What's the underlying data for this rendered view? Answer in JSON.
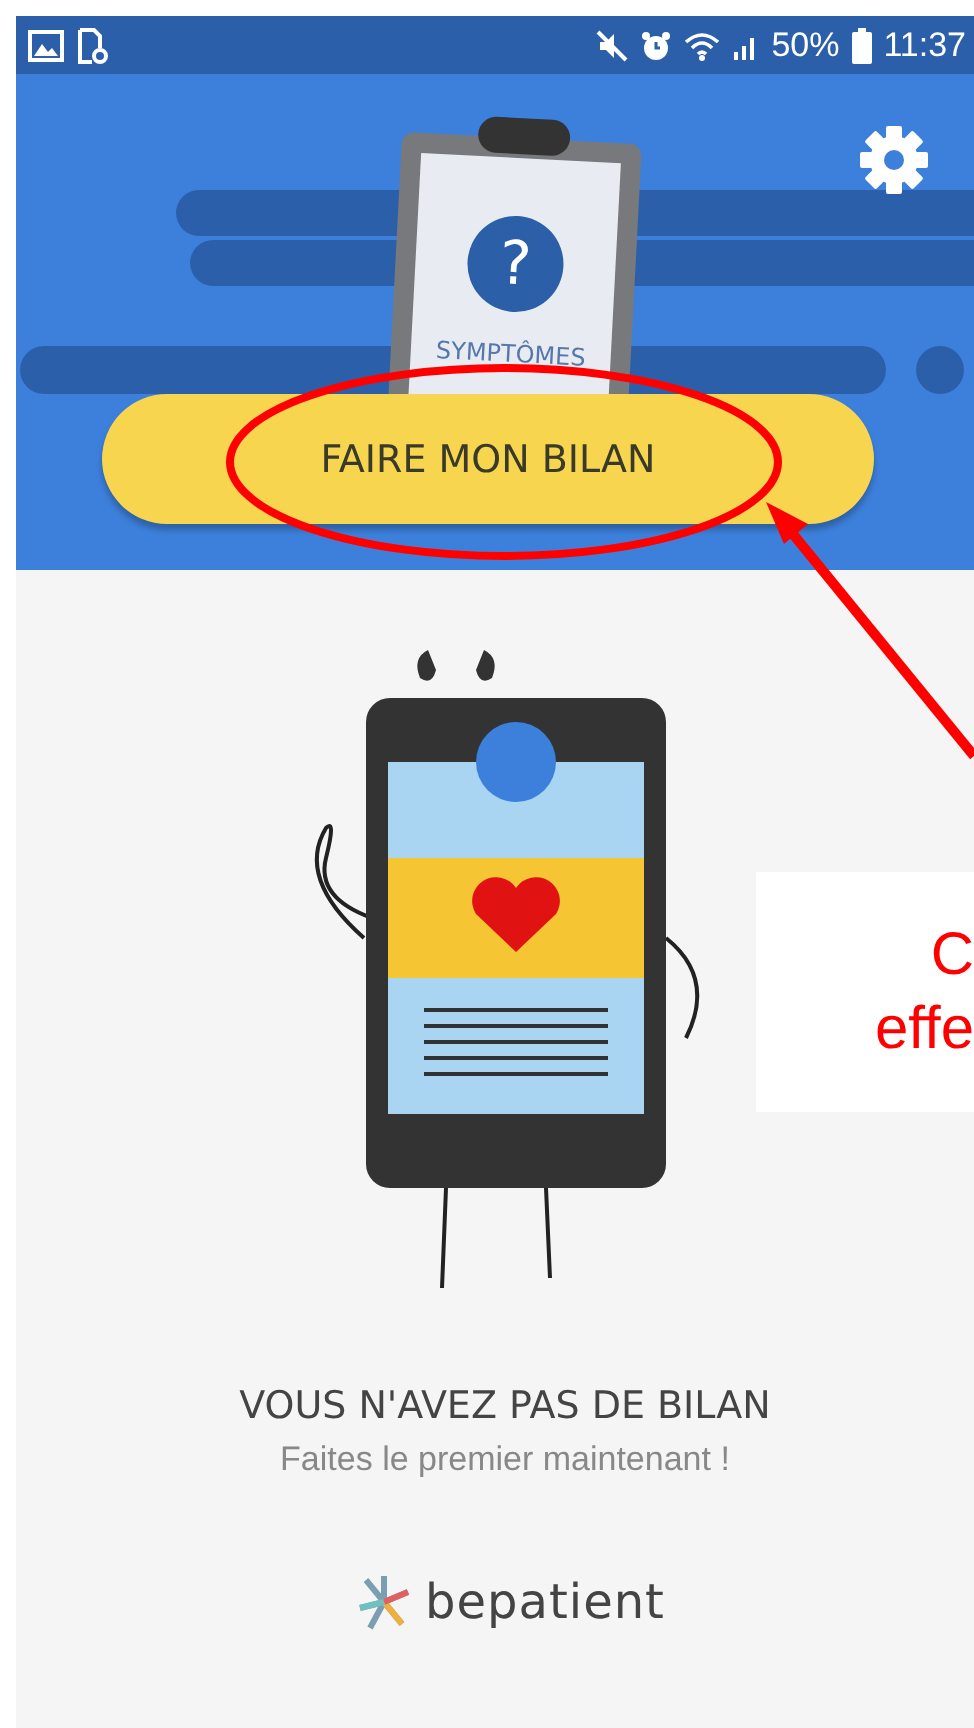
{
  "status_bar": {
    "battery": "50%",
    "time": "11:37"
  },
  "header": {
    "clipboard_symbol": "?",
    "clipboard_label": "SYMPTÔMES",
    "button": "FAIRE MON BILAN"
  },
  "empty_state": {
    "title": "VOUS N'AVEZ PAS DE BILAN",
    "subtitle": "Faites le premier maintenant !"
  },
  "brand": "bepatient",
  "callout": {
    "lines": [
      "C",
      "effe"
    ]
  }
}
